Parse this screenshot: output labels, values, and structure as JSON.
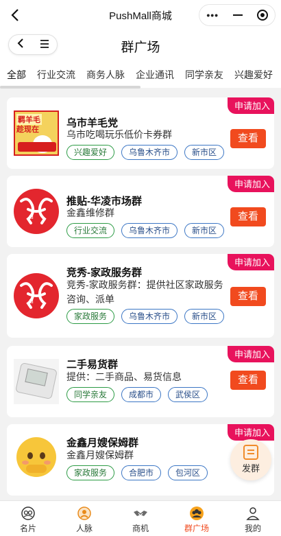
{
  "app_bar": {
    "title": "PushMall商城"
  },
  "page": {
    "title": "群广场"
  },
  "tabs": [
    "全部",
    "行业交流",
    "商务人脉",
    "企业通讯",
    "同学亲友",
    "兴趣爱好"
  ],
  "apply_label": "申请加入",
  "view_label": "查看",
  "groups": [
    {
      "name": "乌市羊毛党",
      "desc": "乌市吃喝玩乐低价卡券群",
      "tags": [
        "兴趣爱好",
        "乌鲁木齐市",
        "新市区"
      ],
      "thumb_text_1": "羁羊毛",
      "thumb_text_2": "趁现在"
    },
    {
      "name": "推贴-华凌市场群",
      "desc": "金鑫维修群",
      "tags": [
        "行业交流",
        "乌鲁木齐市",
        "新市区"
      ]
    },
    {
      "name": "竞秀-家政服务群",
      "desc": "竞秀-家政服务群：提供社区家政服务咨询、派单",
      "tags": [
        "家政服务",
        "乌鲁木齐市",
        "新市区"
      ]
    },
    {
      "name": "二手易货群",
      "desc": "提供：二手商品、易货信息",
      "tags": [
        "同学亲友",
        "成都市",
        "武侯区"
      ]
    },
    {
      "name": "金鑫月嫂保姆群",
      "desc": "金鑫月嫂保姆群",
      "tags": [
        "家政服务",
        "合肥市",
        "包河区"
      ]
    }
  ],
  "float_button": {
    "label": "发群"
  },
  "tabbar": [
    {
      "label": "名片",
      "icon": "card-icon"
    },
    {
      "label": "人脉",
      "icon": "network-icon"
    },
    {
      "label": "商机",
      "icon": "handshake-icon"
    },
    {
      "label": "群广场",
      "icon": "group-icon"
    },
    {
      "label": "我的",
      "icon": "profile-icon"
    }
  ],
  "colors": {
    "accent": "#f14a1e",
    "badge": "#e8125c",
    "tag_green": "#2a9a43",
    "tag_blue": "#3a75c4"
  }
}
